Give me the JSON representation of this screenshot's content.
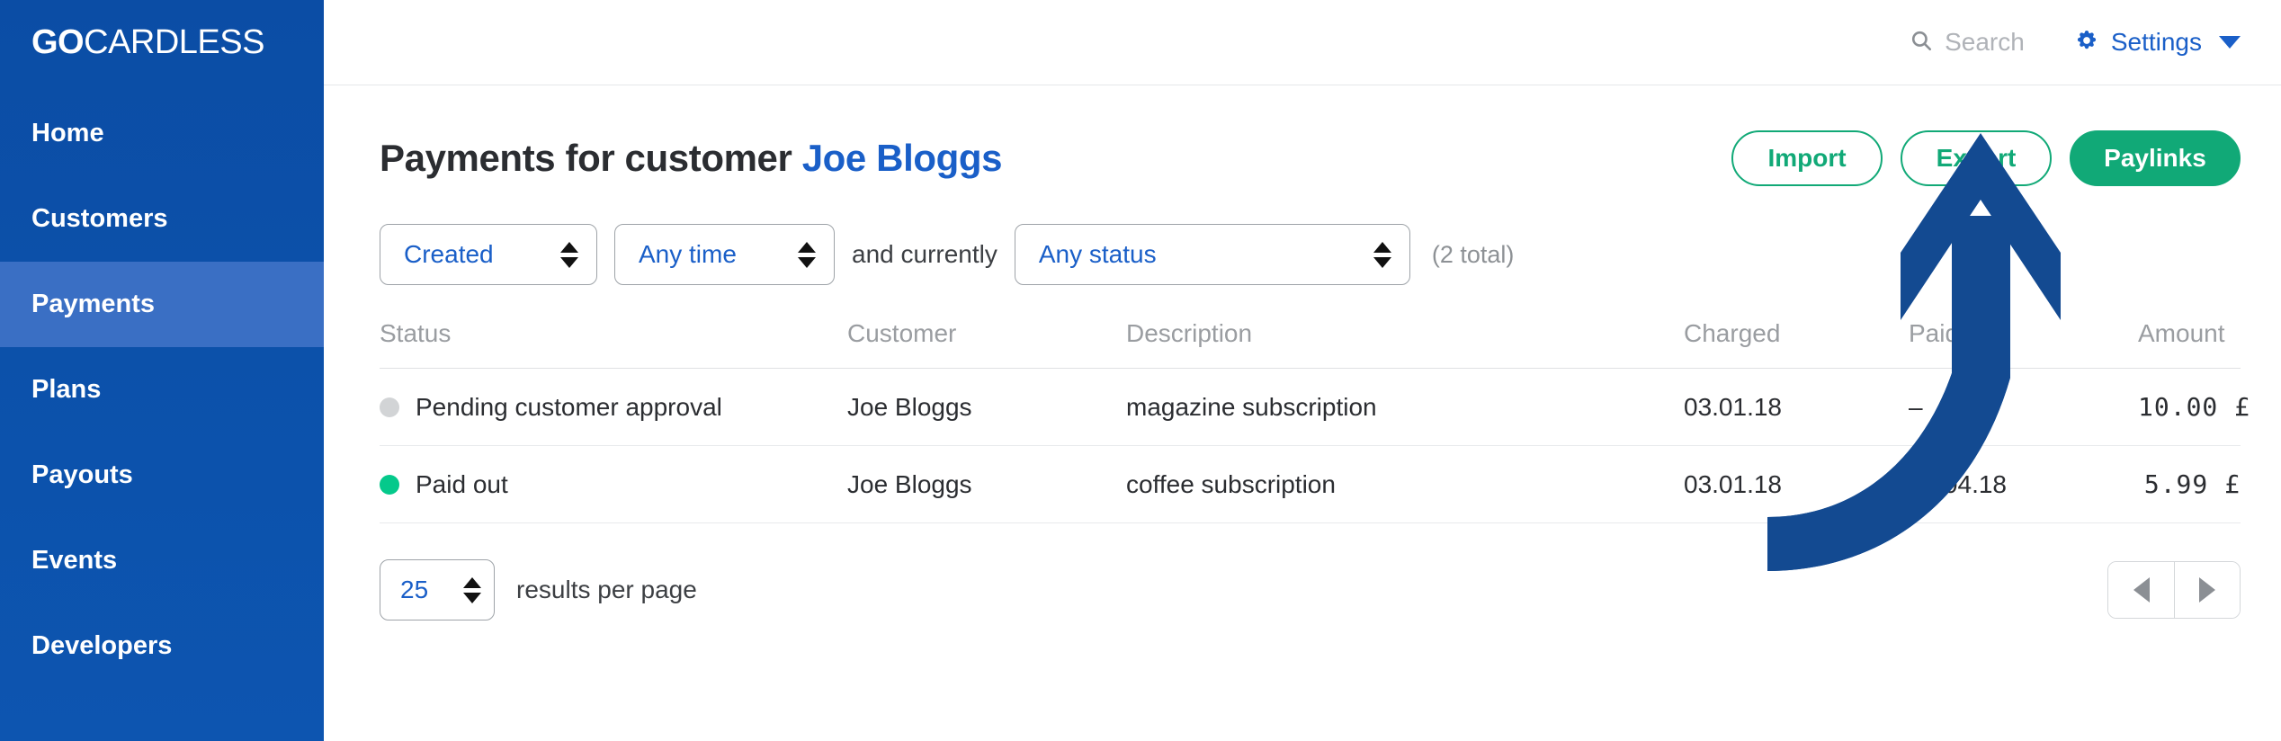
{
  "brand": {
    "logo_bold": "GO",
    "logo_light": "CARDLESS",
    "sidebar_color": "#0d55b0",
    "sidebar_active_color": "#3a6fc4",
    "link_color": "#1a5fc8",
    "accent_green": "#11a977",
    "annotation_color": "#134a91"
  },
  "sidebar": {
    "items": [
      {
        "label": "Home",
        "active": false
      },
      {
        "label": "Customers",
        "active": false
      },
      {
        "label": "Payments",
        "active": true
      },
      {
        "label": "Plans",
        "active": false
      },
      {
        "label": "Payouts",
        "active": false
      },
      {
        "label": "Events",
        "active": false
      },
      {
        "label": "Developers",
        "active": false
      }
    ]
  },
  "topbar": {
    "search_label": "Search",
    "settings_label": "Settings"
  },
  "page": {
    "title_prefix": "Payments for customer",
    "title_customer": "Joe Bloggs"
  },
  "actions": {
    "import_label": "Import",
    "export_label": "Export",
    "paylinks_label": "Paylinks"
  },
  "filters": {
    "field_select": "Created",
    "time_select": "Any time",
    "conjunction": "and currently",
    "status_select": "Any status",
    "total_text": "(2 total)"
  },
  "table": {
    "columns": [
      "Status",
      "Customer",
      "Description",
      "Charged",
      "Paid out",
      "Amount"
    ],
    "rows": [
      {
        "status": "Pending customer approval",
        "status_dot": "grey",
        "customer": "Joe Bloggs",
        "description": "magazine subscription",
        "charged": "03.01.18",
        "paid_out": "–",
        "amount": "10.00 £"
      },
      {
        "status": "Paid out",
        "status_dot": "green",
        "customer": "Joe Bloggs",
        "description": "coffee subscription",
        "charged": "03.01.18",
        "paid_out": "30.04.18",
        "amount": "5.99 £"
      }
    ]
  },
  "footer": {
    "per_page_value": "25",
    "per_page_label": "results per page"
  }
}
